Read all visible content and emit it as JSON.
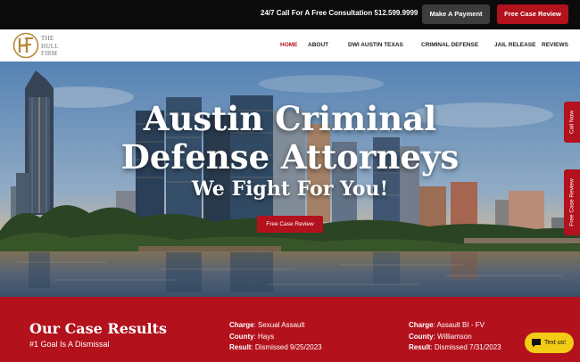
{
  "topbar": {
    "phone_text": "24/7 Call For A Free Consultation 512.599.9999",
    "make_payment": "Make A Payment",
    "free_case_review": "Free Case Review"
  },
  "logo": {
    "line1": "THE",
    "line2": "HULL",
    "line3": "FIRM"
  },
  "nav": {
    "items": [
      "HOME",
      "ABOUT",
      "DWI AUSTIN TEXAS",
      "CRIMINAL DEFENSE",
      "JAIL RELEASE",
      "REVIEWS"
    ],
    "active": "HOME"
  },
  "hero": {
    "title_line1": "Austin Criminal",
    "title_line2": "Defense Attorneys",
    "subtitle": "We Fight For You!",
    "button": "Free Case Review"
  },
  "side_tabs": {
    "call": "Call Now",
    "free": "Free Case Review"
  },
  "results": {
    "title": "Our Case Results",
    "subtitle": "#1 Goal Is A Dismissal",
    "cases": [
      {
        "charge_label": "Charge",
        "charge": "Sexual Assault",
        "county_label": "County",
        "county": "Hays",
        "result_label": "Result",
        "result": "Dismissed 9/25/2023"
      },
      {
        "charge_label": "Charge",
        "charge": "Assault BI - FV",
        "county_label": "County",
        "county": "Williamson",
        "result_label": "Result",
        "result": "Dismissed 7/31/2023"
      }
    ]
  },
  "chat": {
    "label": "Text us!"
  },
  "colors": {
    "brand_red": "#b3111c",
    "topbar_bg": "#0b0b0b",
    "chat_yellow": "#f3cc15"
  }
}
